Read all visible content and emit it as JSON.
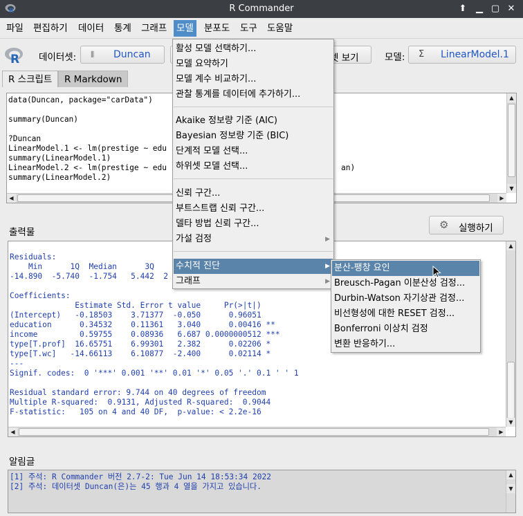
{
  "window": {
    "title": "R Commander"
  },
  "menubar": [
    "파일",
    "편집하기",
    "데이터",
    "통계",
    "그래프",
    "모델",
    "분포도",
    "도구",
    "도움말"
  ],
  "toolbar": {
    "dataset_label": "데이터셋:",
    "dataset_value": "Duncan",
    "view_button_partial": "셋 보기",
    "model_label": "모델:",
    "model_value": "LinearModel.1"
  },
  "tabs": [
    "R 스크립트",
    "R Markdown"
  ],
  "script_lines": [
    "data(Duncan, package=\"carData\")",
    "",
    "summary(Duncan)",
    "",
    "?Duncan",
    "LinearModel.1 <- lm(prestige ~ edu",
    "summary(LinearModel.1)",
    "LinearModel.2 <- lm(prestige ~ edu",
    "summary(LinearModel.2)"
  ],
  "script_right_fragment": "an)",
  "output": {
    "label": "출력물",
    "run_button": "실행하기",
    "lines": [
      "",
      "Residuals:",
      "    Min      1Q  Median      3Q",
      "-14.890  -5.740  -1.754   5.442  2",
      "",
      "Coefficients:",
      "              Estimate Std. Error t value     Pr(>|t|)",
      "(Intercept)   -0.18503    3.71377  -0.050      0.96051",
      "education      0.34532    0.11361   3.040      0.00416 **",
      "income         0.59755    0.08936   6.687 0.0000000512 ***",
      "type[T.prof]  16.65751    6.99301   2.382      0.02206 *",
      "type[T.wc]   -14.66113    6.10877  -2.400      0.02114 *",
      "---",
      "Signif. codes:  0 '***' 0.001 '**' 0.01 '*' 0.05 '.' 0.1 ' ' 1",
      "",
      "Residual standard error: 9.744 on 40 degrees of freedom",
      "Multiple R-squared:  0.9131, Adjusted R-squared:  0.9044",
      "F-statistic:   105 on 4 and 40 DF,  p-value: < 2.2e-16"
    ]
  },
  "messages": {
    "label": "알림글",
    "lines": [
      "[1] 주석: R Commander 버전 2.7-2: Tue Jun 14 18:53:34 2022",
      "[2] 주석: 데이터셋 Duncan(은)는 45 행과 4 열을 가지고 있습니다."
    ]
  },
  "model_menu": {
    "group1": [
      "활성 모델 선택하기...",
      "모델 요약하기",
      "모델 계수 비교하기...",
      "관찰 통계를 데이터에 추가하기..."
    ],
    "group2": [
      "Akaike 정보량 기준 (AIC)",
      "Bayesian 정보량 기준 (BIC)",
      "단계적 모델 선택...",
      "하위셋 모델 선택..."
    ],
    "group3": [
      "신뢰 구간...",
      "부트스트랩 신뢰 구간...",
      "델타 방법 신뢰 구간...",
      "가설 검정"
    ],
    "group4": [
      "수치적 진단",
      "그래프"
    ]
  },
  "diagnostics_submenu": [
    "분산-팽창 요인",
    "Breusch-Pagan 이분산성 검정...",
    "Durbin-Watson 자기상관 검정...",
    "비선형성에 대한 RESET 검정...",
    "Bonferroni 이상치 검정",
    "변환 반응하기..."
  ],
  "colors": {
    "titlebar": "#3b3f43",
    "menu_highlight": "#4f8dc9",
    "item_highlight": "#5b84ab",
    "link_blue": "#1e56c6",
    "messages_blue": "#1f3fae"
  }
}
